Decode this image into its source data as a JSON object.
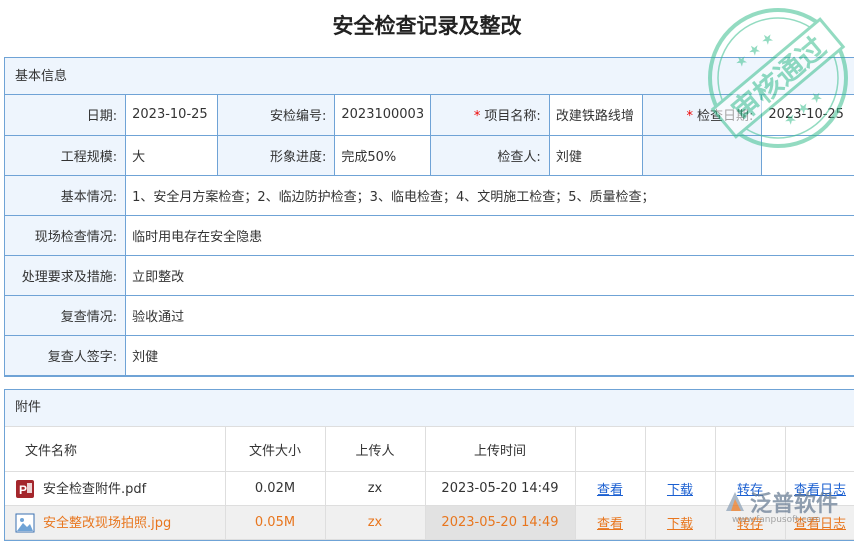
{
  "title": "安全检查记录及整改",
  "basic": {
    "header": "基本信息",
    "date_label": "日期:",
    "date": "2023-10-25",
    "code_label": "安检编号:",
    "code": "2023100003",
    "project_label": "项目名称:",
    "project": "改建铁路线增",
    "check_date_label": "检查日期:",
    "check_date": "2023-10-25",
    "scale_label": "工程规模:",
    "scale": "大",
    "progress_label": "形象进度:",
    "progress": "完成50%",
    "inspector_label": "检查人:",
    "inspector": "刘健",
    "situation_label": "基本情况:",
    "situation": "1、安全月方案检查；2、临边防护检查；3、临电检查；4、文明施工检查；5、质量检查；",
    "site_label": "现场检查情况:",
    "site": "临时用电存在安全隐患",
    "measures_label": "处理要求及措施:",
    "measures": "立即整改",
    "recheck_label": "复查情况:",
    "recheck": "验收通过",
    "signer_label": "复查人签字:",
    "signer": "刘健"
  },
  "stamp_text": "审核通过",
  "attachments": {
    "header": "附件",
    "columns": [
      "文件名称",
      "文件大小",
      "上传人",
      "上传时间"
    ],
    "rows": [
      {
        "name": "安全检查附件.pdf",
        "icon": "pdf-icon",
        "size": "0.02M",
        "uploader": "zx",
        "time": "2023-05-20 14:49",
        "view": "查看",
        "download": "下载",
        "transfer": "转存",
        "log": "查看日志"
      },
      {
        "name": "安全整改现场拍照.jpg",
        "icon": "image-icon",
        "size": "0.05M",
        "uploader": "zx",
        "time": "2023-05-20 14:49",
        "view": "查看",
        "download": "下载",
        "transfer": "转存",
        "log": "查看日志"
      }
    ]
  },
  "watermark": {
    "brand": "泛普软件",
    "url": "www.fanpusoft.com"
  },
  "colors": {
    "border": "#6fa3d6",
    "label_bg": "#eef5fd",
    "link": "#1a5fd1",
    "selected_text": "#e8761e",
    "stamp": "#3cbf8f"
  }
}
